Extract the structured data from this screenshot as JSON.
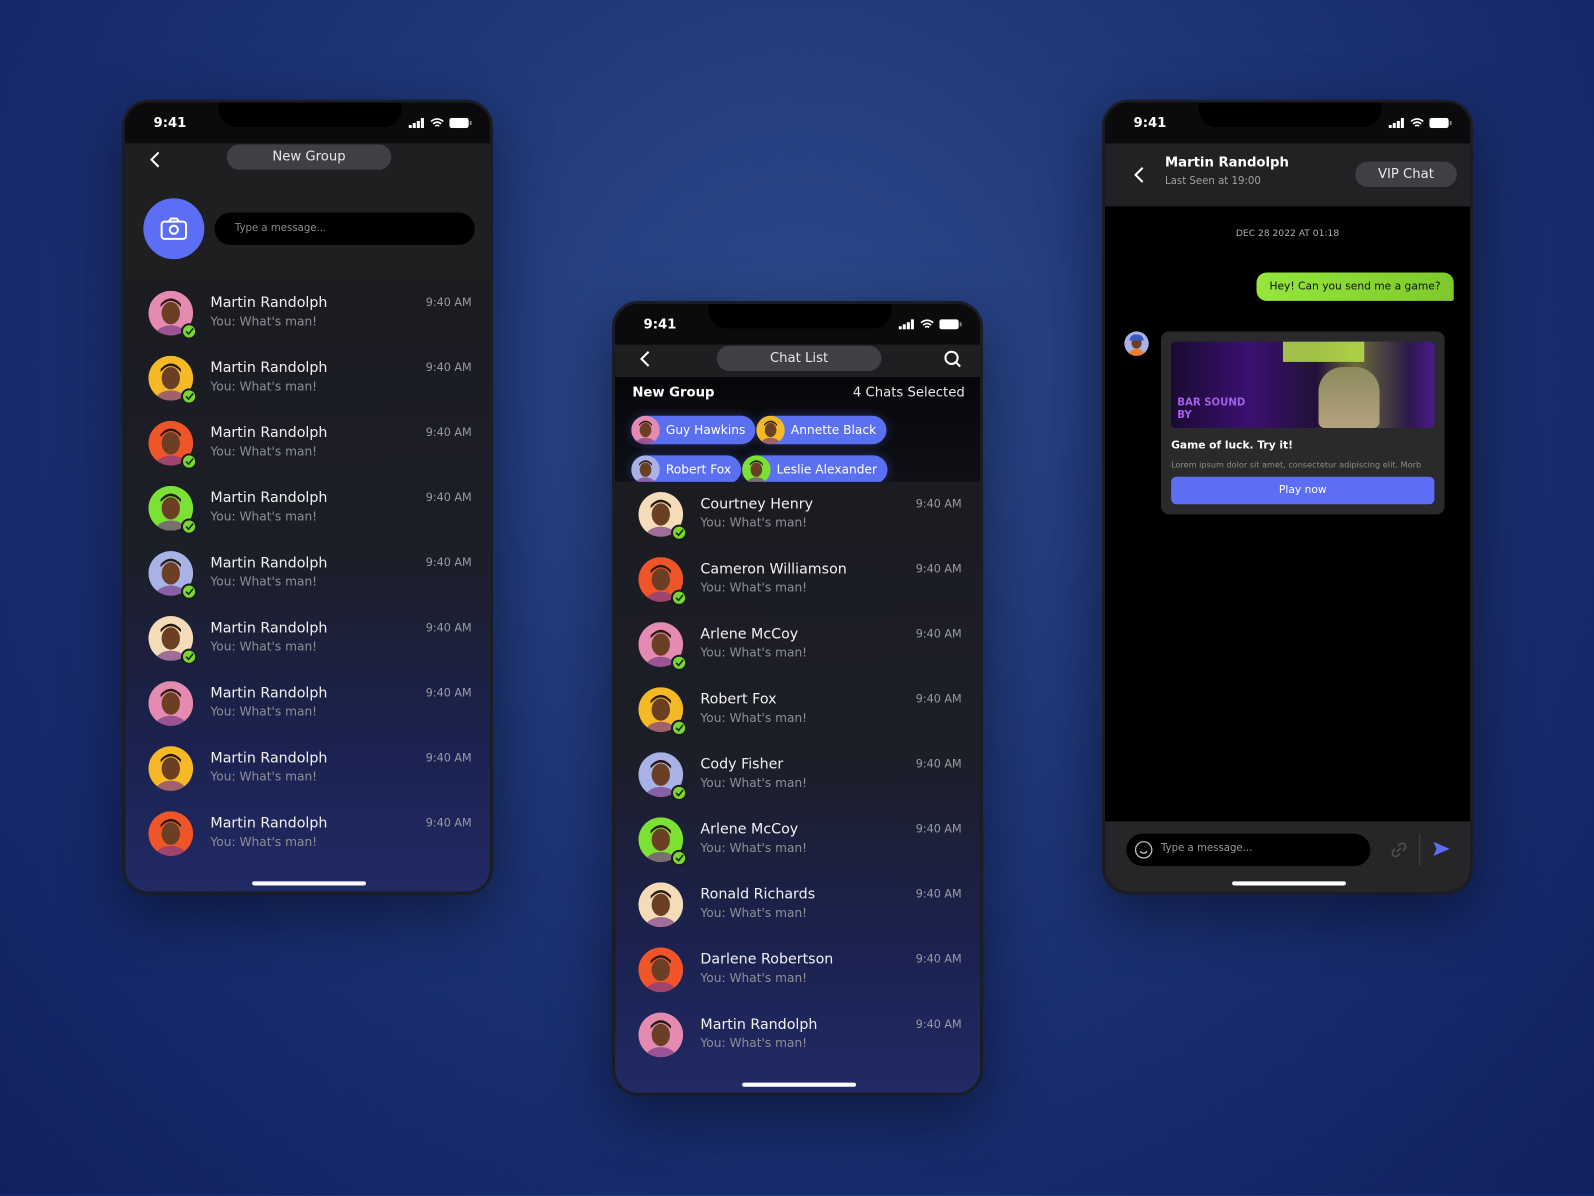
{
  "status_time": "9:41",
  "colors": {
    "accent": "#5b6ef5",
    "online": "#7cd631",
    "bubble": "#8fe03a"
  },
  "left_phone": {
    "title": "New Group",
    "input_placeholder": "Type a message...",
    "camera_icon": "camera-icon",
    "chats": [
      {
        "name": "Martin Randolph",
        "message": "You: What's man!",
        "time": "9:40 AM",
        "avatar": "#e58ab0",
        "online": true
      },
      {
        "name": "Martin Randolph",
        "message": "You: What's man!",
        "time": "9:40 AM",
        "avatar": "#f6b926",
        "online": true
      },
      {
        "name": "Martin Randolph",
        "message": "You: What's man!",
        "time": "9:40 AM",
        "avatar": "#f0552a",
        "online": true
      },
      {
        "name": "Martin Randolph",
        "message": "You: What's man!",
        "time": "9:40 AM",
        "avatar": "#7be234",
        "online": true
      },
      {
        "name": "Martin Randolph",
        "message": "You: What's man!",
        "time": "9:40 AM",
        "avatar": "#a9b2e6",
        "online": true
      },
      {
        "name": "Martin Randolph",
        "message": "You: What's man!",
        "time": "9:40 AM",
        "avatar": "#f4dcb8",
        "online": true
      },
      {
        "name": "Martin Randolph",
        "message": "You: What's man!",
        "time": "9:40 AM",
        "avatar": "#e58ab0",
        "online": false
      },
      {
        "name": "Martin Randolph",
        "message": "You: What's man!",
        "time": "9:40 AM",
        "avatar": "#f6b926",
        "online": false
      },
      {
        "name": "Martin Randolph",
        "message": "You: What's man!",
        "time": "9:40 AM",
        "avatar": "#f0552a",
        "online": false
      }
    ]
  },
  "middle_phone": {
    "title": "Chat List",
    "section_title": "New Group",
    "selected_count": "4 Chats Selected",
    "selected": [
      {
        "name": "Guy Hawkins",
        "avatar": "#e58ab0"
      },
      {
        "name": "Annette Black",
        "avatar": "#f6b926"
      },
      {
        "name": "Robert Fox",
        "avatar": "#a9b2e6"
      },
      {
        "name": "Leslie Alexander",
        "avatar": "#7be234"
      }
    ],
    "chats": [
      {
        "name": "Courtney Henry",
        "message": "You: What's man!",
        "time": "9:40 AM",
        "avatar": "#f4dcb8",
        "online": true
      },
      {
        "name": "Cameron Williamson",
        "message": "You: What's man!",
        "time": "9:40 AM",
        "avatar": "#f0552a",
        "online": true
      },
      {
        "name": "Arlene McCoy",
        "message": "You: What's man!",
        "time": "9:40 AM",
        "avatar": "#e58ab0",
        "online": true
      },
      {
        "name": "Robert Fox",
        "message": "You: What's man!",
        "time": "9:40 AM",
        "avatar": "#f6b926",
        "online": true
      },
      {
        "name": "Cody Fisher",
        "message": "You: What's man!",
        "time": "9:40 AM",
        "avatar": "#a9b2e6",
        "online": true
      },
      {
        "name": "Arlene McCoy",
        "message": "You: What's man!",
        "time": "9:40 AM",
        "avatar": "#7be234",
        "online": true
      },
      {
        "name": "Ronald Richards",
        "message": "You: What's man!",
        "time": "9:40 AM",
        "avatar": "#f4dcb8",
        "online": false
      },
      {
        "name": "Darlene Robertson",
        "message": "You: What's man!",
        "time": "9:40 AM",
        "avatar": "#f0552a",
        "online": false
      },
      {
        "name": "Martin Randolph",
        "message": "You: What's man!",
        "time": "9:40 AM",
        "avatar": "#e58ab0",
        "online": false
      }
    ]
  },
  "right_phone": {
    "contact_name": "Martin Randolph",
    "last_seen": "Last Seen at 19:00",
    "vip_label": "VIP Chat",
    "date_divider": "DEC 28 2022 AT 01:18",
    "sent_message": "Hey! Can you send me a game?",
    "card": {
      "image_text": "BAR SOUND BY",
      "title": "Game of luck. Try it!",
      "description": "Lorem ipsum dolor sit amet, consectetur adipiscing elit. Morb",
      "button": "Play now"
    },
    "input_placeholder": "Type a message..."
  }
}
